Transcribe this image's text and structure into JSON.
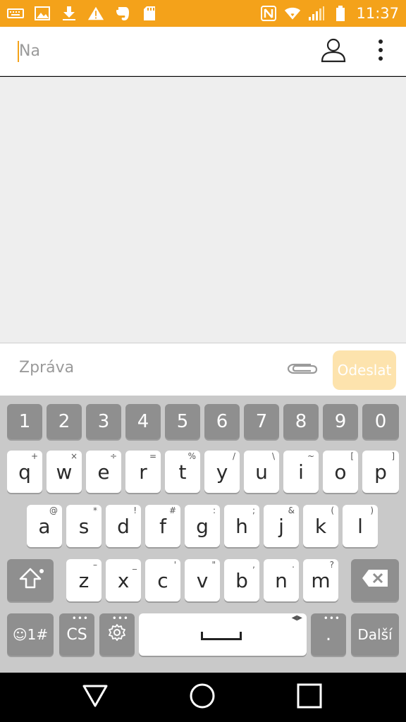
{
  "status_bar": {
    "time": "11:37",
    "background": "#f4a21a",
    "left_icons": [
      "keyboard-icon",
      "image-icon",
      "download-icon",
      "warning-icon",
      "evernote-icon",
      "sd-card-icon"
    ],
    "right_icons": [
      "nfc-icon",
      "wifi-icon",
      "signal-icon",
      "battery-icon"
    ]
  },
  "recipient": {
    "placeholder": "Na"
  },
  "compose": {
    "placeholder": "Zpráva",
    "send_label": "Odeslat",
    "send_color": "#fde3ad"
  },
  "keyboard": {
    "numbers": [
      "1",
      "2",
      "3",
      "4",
      "5",
      "6",
      "7",
      "8",
      "9",
      "0"
    ],
    "row1": [
      {
        "key": "q",
        "hint": "+"
      },
      {
        "key": "w",
        "hint": "×"
      },
      {
        "key": "e",
        "hint": "÷"
      },
      {
        "key": "r",
        "hint": "="
      },
      {
        "key": "t",
        "hint": "%"
      },
      {
        "key": "y",
        "hint": "/"
      },
      {
        "key": "u",
        "hint": "\\"
      },
      {
        "key": "i",
        "hint": "~"
      },
      {
        "key": "o",
        "hint": "["
      },
      {
        "key": "p",
        "hint": "]"
      }
    ],
    "row2": [
      {
        "key": "a",
        "hint": "@"
      },
      {
        "key": "s",
        "hint": "*"
      },
      {
        "key": "d",
        "hint": "!"
      },
      {
        "key": "f",
        "hint": "#"
      },
      {
        "key": "g",
        "hint": ":"
      },
      {
        "key": "h",
        "hint": ";"
      },
      {
        "key": "j",
        "hint": "&"
      },
      {
        "key": "k",
        "hint": "("
      },
      {
        "key": "l",
        "hint": ")"
      }
    ],
    "row3": [
      {
        "key": "z",
        "hint": "–"
      },
      {
        "key": "x",
        "hint": "_"
      },
      {
        "key": "c",
        "hint": "'"
      },
      {
        "key": "v",
        "hint": "\""
      },
      {
        "key": "b",
        "hint": ","
      },
      {
        "key": "n",
        "hint": "."
      },
      {
        "key": "m",
        "hint": "?"
      }
    ],
    "symbols_label": "☺1#",
    "language_label": "CS",
    "period_label": ".",
    "next_label": "Další"
  }
}
